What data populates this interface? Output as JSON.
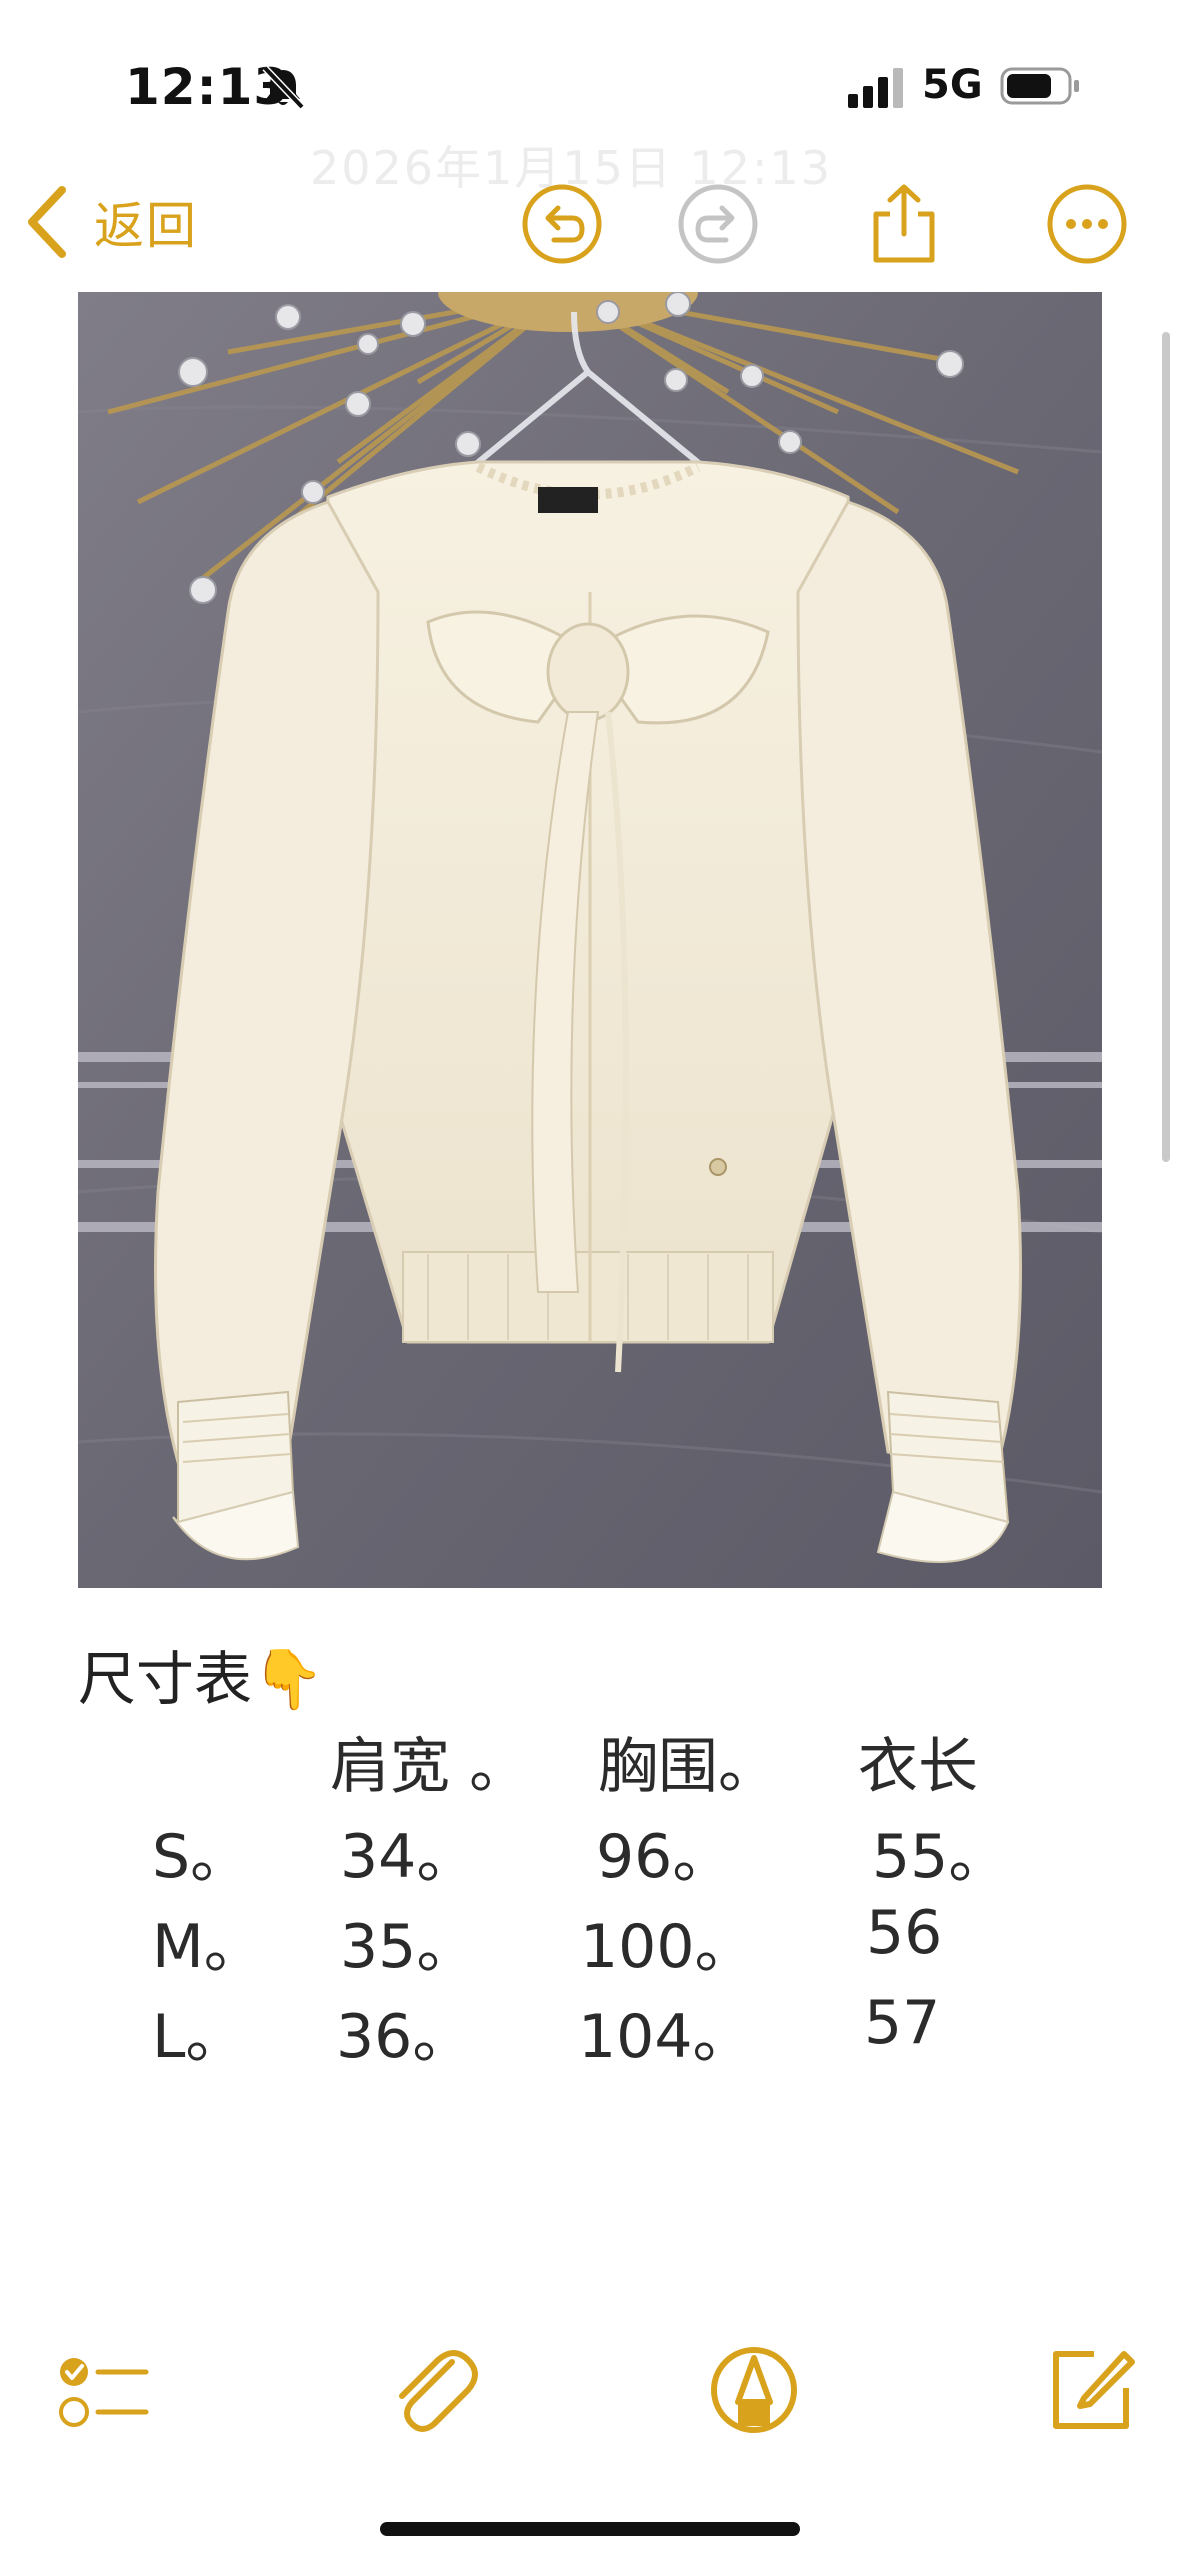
{
  "status_bar": {
    "time": "12:13",
    "network": "5G",
    "icons": [
      "bell-slash-icon",
      "cellular-signal-icon",
      "battery-icon"
    ]
  },
  "nav": {
    "back_label": "返回",
    "date_ghost": "2026年1月15日 12:13",
    "toolbar_icons": [
      "undo-icon",
      "redo-icon",
      "share-icon",
      "more-icon"
    ]
  },
  "note": {
    "heading": "尺寸表👇",
    "table": {
      "headers": [
        "",
        "肩宽 。",
        "胸围。",
        "衣长"
      ],
      "rows": [
        [
          "S。",
          "34。",
          "96。",
          "55。"
        ],
        [
          "M。",
          "35。",
          "100。",
          "56"
        ],
        [
          "L。",
          "36。",
          "104。",
          "57"
        ]
      ]
    }
  },
  "bottom_toolbar": {
    "icons": [
      "checklist-icon",
      "paperclip-icon",
      "markup-icon",
      "compose-icon"
    ]
  },
  "colors": {
    "accent": "#d8a21c",
    "wall": "#6f6d78",
    "garment": "#f3ecdc",
    "text": "#2b2b2b"
  }
}
